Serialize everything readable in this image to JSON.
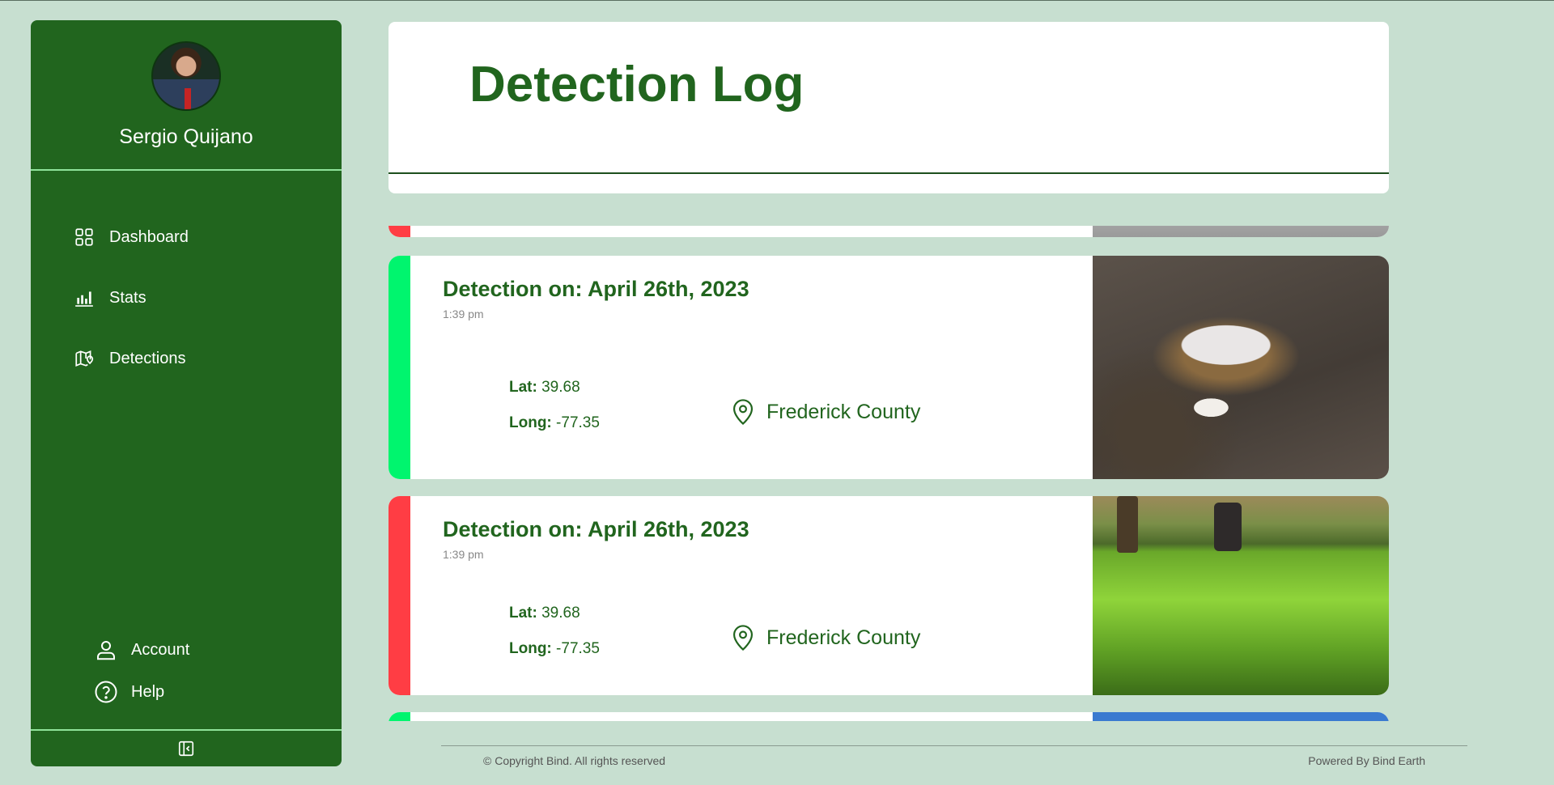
{
  "user": {
    "name": "Sergio Quijano"
  },
  "nav": {
    "items": [
      {
        "label": "Dashboard",
        "icon": "grid-icon"
      },
      {
        "label": "Stats",
        "icon": "bar-chart-icon"
      },
      {
        "label": "Detections",
        "icon": "map-pin-icon"
      }
    ],
    "bottom": [
      {
        "label": "Account",
        "icon": "user-icon"
      },
      {
        "label": "Help",
        "icon": "help-circle-icon"
      }
    ],
    "collapse_icon": "collapse-sidebar-icon"
  },
  "header": {
    "title": "Detection Log"
  },
  "detections": [
    {
      "title": "Detection on: April 26th, 2023",
      "time": "1:39 pm",
      "lat_label": "Lat:",
      "lat": "39.68",
      "long_label": "Long:",
      "long": "-77.35",
      "location": "Frederick County",
      "status_color": "#00f56e"
    },
    {
      "title": "Detection on: April 26th, 2023",
      "time": "1:39 pm",
      "lat_label": "Lat:",
      "lat": "39.68",
      "long_label": "Long:",
      "long": "-77.35",
      "location": "Frederick County",
      "status_color": "#ff3d44"
    }
  ],
  "footer": {
    "copyright": "© Copyright Bind. All rights reserved",
    "powered": "Powered By Bind Earth"
  },
  "colors": {
    "brand_green": "#21651e",
    "background": "#c7dfd0",
    "status_clean": "#00f56e",
    "status_trash": "#ff3d44"
  }
}
